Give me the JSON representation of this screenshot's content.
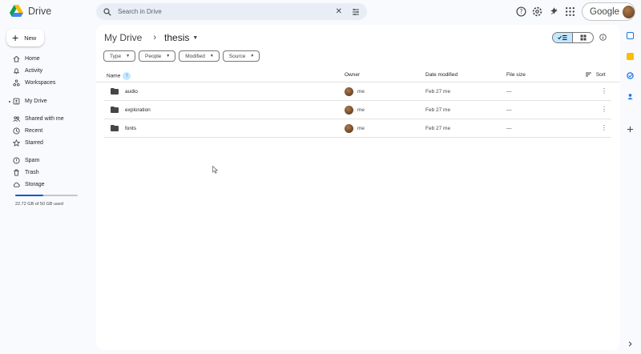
{
  "app": {
    "name": "Drive"
  },
  "search": {
    "placeholder": "Search in Drive"
  },
  "header": {
    "account_label": "Google"
  },
  "sidebar": {
    "new_label": "New",
    "items": [
      {
        "label": "Home",
        "icon": "home-icon"
      },
      {
        "label": "Activity",
        "icon": "bell-icon"
      },
      {
        "label": "Workspaces",
        "icon": "workspaces-icon"
      },
      {
        "label": "My Drive",
        "icon": "my-drive-icon"
      },
      {
        "label": "Shared with me",
        "icon": "people-icon"
      },
      {
        "label": "Recent",
        "icon": "clock-icon"
      },
      {
        "label": "Starred",
        "icon": "star-icon"
      },
      {
        "label": "Spam",
        "icon": "spam-icon"
      },
      {
        "label": "Trash",
        "icon": "trash-icon"
      },
      {
        "label": "Storage",
        "icon": "cloud-icon"
      }
    ],
    "storage_text": "22.72 GB of 50 GB used",
    "storage_fraction": 0.45
  },
  "breadcrumb": {
    "root": "My Drive",
    "current": "thesis"
  },
  "filters": [
    "Type",
    "People",
    "Modified",
    "Source"
  ],
  "table": {
    "headers": {
      "name": "Name",
      "owner": "Owner",
      "date": "Date modified",
      "size": "File size",
      "sort": "Sort"
    },
    "rows": [
      {
        "name": "audio",
        "owner": "me",
        "date": "Feb 27 me",
        "size": "—"
      },
      {
        "name": "exploration",
        "owner": "me",
        "date": "Feb 27 me",
        "size": "—"
      },
      {
        "name": "fonts",
        "owner": "me",
        "date": "Feb 27 me",
        "size": "—"
      }
    ]
  },
  "colors": {
    "accent": "#0b57d0",
    "selected": "#c2e7ff",
    "background": "#f8fafd"
  }
}
